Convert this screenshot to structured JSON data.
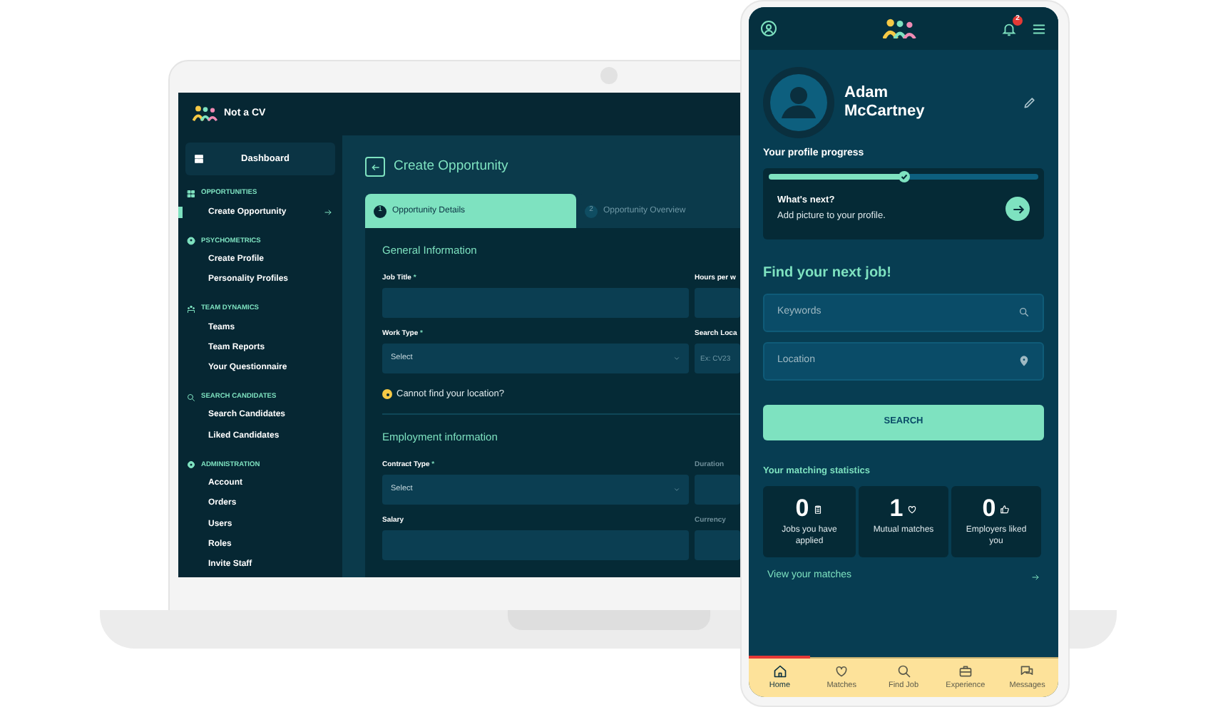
{
  "laptop": {
    "brand": "Not a CV",
    "sidebar": {
      "dashboard": "Dashboard",
      "sections": [
        {
          "title": "OPPORTUNITIES",
          "items": [
            {
              "label": "Create Opportunity",
              "selected": true
            }
          ]
        },
        {
          "title": "PSYCHOMETRICS",
          "items": [
            {
              "label": "Create Profile",
              "selected": false
            },
            {
              "label": "Personality Profiles",
              "selected": false
            }
          ]
        },
        {
          "title": "TEAM DYNAMICS",
          "items": [
            {
              "label": "Teams",
              "selected": false
            },
            {
              "label": "Team Reports",
              "selected": false
            },
            {
              "label": "Your Questionnaire",
              "selected": false
            }
          ]
        },
        {
          "title": "SEARCH CANDIDATES",
          "items": [
            {
              "label": "Search Candidates",
              "selected": false
            },
            {
              "label": "Liked Candidates",
              "selected": false
            }
          ]
        },
        {
          "title": "ADMINISTRATION",
          "items": [
            {
              "label": "Account",
              "selected": false
            },
            {
              "label": "Orders",
              "selected": false
            },
            {
              "label": "Users",
              "selected": false
            },
            {
              "label": "Roles",
              "selected": false
            },
            {
              "label": "Invite Staff",
              "selected": false
            }
          ]
        }
      ]
    },
    "page": {
      "title": "Create Opportunity",
      "steps": [
        {
          "number": "1",
          "label": "Opportunity Details",
          "selected": true
        },
        {
          "number": "2",
          "label": "Opportunity Overview",
          "selected": false
        }
      ],
      "sections": [
        {
          "heading": "General Information",
          "rows": [
            [
              {
                "label": "Job Title",
                "mark": "*",
                "kind": "text",
                "disabled": false
              },
              {
                "label": "Hours per w",
                "kind": "text",
                "disabled": false
              }
            ],
            [
              {
                "label": "Work Type",
                "mark": "*",
                "kind": "select",
                "value": "Select",
                "disabled": false
              },
              {
                "label": "Search Loca",
                "kind": "text",
                "placeholder": "Ex: CV23",
                "disabled": false
              }
            ]
          ],
          "note": "Cannot find your location?"
        },
        {
          "heading": "Employment information",
          "rows": [
            [
              {
                "label": "Contract Type",
                "mark": "*",
                "kind": "select",
                "value": "Select",
                "disabled": false
              },
              {
                "label": "Duration",
                "kind": "text",
                "disabled": true
              }
            ],
            [
              {
                "label": "Salary",
                "kind": "text",
                "disabled": false
              },
              {
                "label": "Currency",
                "kind": "text",
                "disabled": true
              }
            ]
          ]
        }
      ]
    }
  },
  "phone": {
    "notifications": "2",
    "profile": {
      "name": "Adam McCartney",
      "progress_label": "Your profile progress",
      "level": 0.5,
      "next_title": "What's next?",
      "next_text": "Add picture to your profile."
    },
    "search": {
      "heading": "Find your next job!",
      "fields": [
        {
          "placeholder": "Keywords",
          "kind": "search"
        },
        {
          "placeholder": "Location",
          "kind": "location"
        }
      ],
      "button": "SEARCH"
    },
    "stats": {
      "title": "Your matching statistics",
      "items": [
        {
          "value": "0",
          "label": "Jobs you have applied",
          "kind": "applied"
        },
        {
          "value": "1",
          "label": "Mutual matches",
          "kind": "matches"
        },
        {
          "value": "0",
          "label": "Employers liked you",
          "kind": "liked"
        }
      ],
      "link": "View your matches"
    },
    "nav": [
      {
        "label": "Home",
        "selected": true,
        "kind": "home"
      },
      {
        "label": "Matches",
        "selected": false,
        "kind": "heart"
      },
      {
        "label": "Find Job",
        "selected": false,
        "kind": "search"
      },
      {
        "label": "Experience",
        "selected": false,
        "kind": "briefcase"
      },
      {
        "label": "Messages",
        "selected": false,
        "kind": "chat"
      }
    ]
  }
}
